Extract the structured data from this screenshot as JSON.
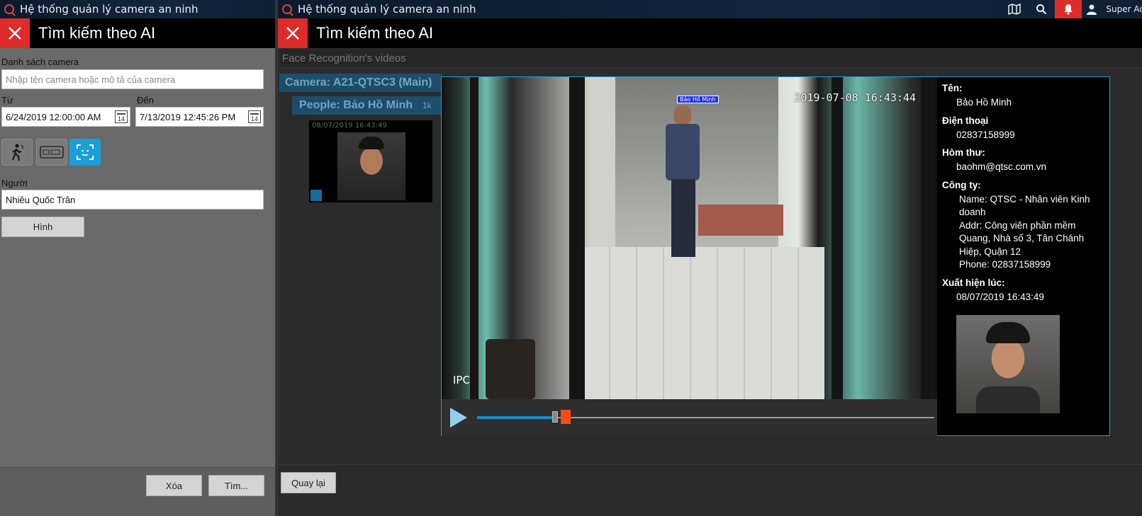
{
  "left_window": {
    "title": "Hệ thống quản lý camera an ninh",
    "panel_title": "Tìm kiếm theo AI",
    "camera_list_label": "Danh sách camera",
    "camera_search_placeholder": "Nhập tên camera hoặc mô tả của camera",
    "from_label": "Từ",
    "from_value": "6/24/2019 12:00:00 AM",
    "to_label": "Đến",
    "to_value": "7/13/2019 12:45:26 PM",
    "calendar_day": "14",
    "person_label": "Người",
    "person_value": "Nhiêu Quốc Trân",
    "image_button": "Hình",
    "delete_button": "Xóa",
    "search_button": "Tìm..."
  },
  "right_window": {
    "title": "Hệ thống quản lý camera an ninh",
    "user": "Super Ad",
    "panel_title": "Tìm kiếm theo AI",
    "subtitle": "Face Recognition's videos",
    "camera_group": "Camera: A21-QTSC3 (Main)",
    "people_group": "People: Bảo Hồ Minh",
    "people_count": "1k",
    "thumbnail_time": "08/07/2019 16:43:49",
    "video_timestamp": "2019-07-08 16:43:44",
    "video_tag": "Bảo Hồ Minh",
    "video_overlay": "IPC",
    "back_button": "Quay lại",
    "progress": 0.17
  },
  "person_info": {
    "name_label": "Tên:",
    "name": "Bảo Hồ Minh",
    "phone_label": "Điện thoại",
    "phone": "02837158999",
    "email_label": "Hòm thư:",
    "email": "baohm@qtsc.com.vn",
    "company_label": "Công ty:",
    "company_name": "Name: QTSC - Nhân viên Kinh doanh",
    "company_addr": "Addr: Công viên phần mềm Quang, Nhà số 3, Tân Chánh Hiệp, Quận 12",
    "company_phone": "Phone: 02837158999",
    "seen_label": "Xuất hiện lúc:",
    "seen_at": "08/07/2019 16:43:49"
  },
  "colors": {
    "accent": "#1a9fd9",
    "close": "#e02b2b",
    "progress_marker": "#ff4a14"
  }
}
